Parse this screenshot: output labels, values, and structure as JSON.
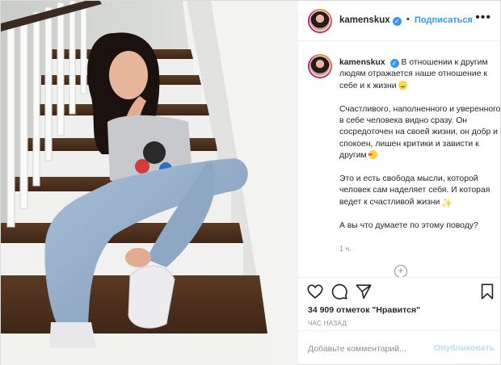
{
  "colors": {
    "accent_blue": "#3897f0",
    "publish_disabled": "#b2dffc",
    "secondary_text": "#8e8e8e",
    "border": "#dbdbdb"
  },
  "header": {
    "username": "kamenskux",
    "verified_icon": "verified-badge-icon",
    "separator": "•",
    "follow_label": "Подписаться",
    "more_icon": "more-options-icon"
  },
  "caption": {
    "username": "kamenskux",
    "paragraph1": "В отношении к другим людям отражается наше отношение к себе и к жизни",
    "paragraph2": "Счастливого, наполненного и уверенного в себе человека видно сразу. Он сосредоточен на своей жизни, он добр и спокоен, лишен критики и зависти к другим",
    "paragraph3": "Это и есть свобода мысли, которой человек сам наделяет себя. И которая ведет к счастливой жизни",
    "paragraph4": "А вы что думаете по этому поводу?",
    "age": "1 ч."
  },
  "actions": {
    "like_icon": "heart-icon",
    "comment_icon": "comment-icon",
    "share_icon": "share-icon",
    "save_icon": "bookmark-icon",
    "likes": "34 909 отметок \"Нравится\"",
    "timestamp": "ЧАС НАЗАД"
  },
  "comment": {
    "placeholder": "Добавьте комментарий...",
    "publish_label": "Опубликовать"
  }
}
